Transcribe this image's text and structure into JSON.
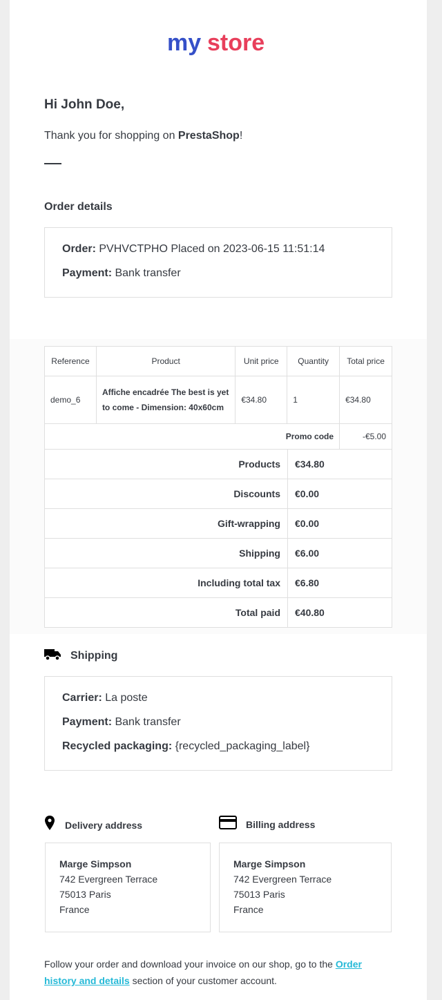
{
  "logo": {
    "text_my": "my",
    "text_store": "store"
  },
  "greeting": "Hi John Doe,",
  "thanks": {
    "prefix": "Thank you for shopping on ",
    "shop": "PrestaShop",
    "suffix": "!"
  },
  "order_details": {
    "title": "Order details",
    "order_label": "Order:",
    "order_value": "PVHVCTPHO Placed on 2023-06-15 11:51:14",
    "payment_label": "Payment:",
    "payment_value": "Bank transfer"
  },
  "products_table": {
    "headers": [
      "Reference",
      "Product",
      "Unit price",
      "Quantity",
      "Total price"
    ],
    "rows": [
      {
        "reference": "demo_6",
        "product": "Affiche encadrée The best is yet to come - Dimension: 40x60cm",
        "unit_price": "€34.80",
        "quantity": "1",
        "total_price": "€34.80"
      }
    ],
    "promo_label": "Promo code",
    "promo_value": "-€5.00"
  },
  "totals": [
    {
      "label": "Products",
      "value": "€34.80"
    },
    {
      "label": "Discounts",
      "value": "€0.00"
    },
    {
      "label": "Gift-wrapping",
      "value": "€0.00"
    },
    {
      "label": "Shipping",
      "value": "€6.00"
    },
    {
      "label": "Including total tax",
      "value": "€6.80"
    },
    {
      "label": "Total paid",
      "value": "€40.80"
    }
  ],
  "shipping": {
    "title": "Shipping",
    "carrier_label": "Carrier:",
    "carrier_value": "La poste",
    "payment_label": "Payment:",
    "payment_value": "Bank transfer",
    "recycled_label": "Recycled packaging:",
    "recycled_value": "{recycled_packaging_label}"
  },
  "delivery_address": {
    "title": "Delivery address",
    "name": "Marge Simpson",
    "street": "742 Evergreen Terrace",
    "city": "75013 Paris",
    "country": "France"
  },
  "billing_address": {
    "title": "Billing address",
    "name": "Marge Simpson",
    "street": "742 Evergreen Terrace",
    "city": "75013 Paris",
    "country": "France"
  },
  "footer": {
    "prefix": "Follow your order and download your invoice on our shop, go to the ",
    "link": "Order history and details",
    "suffix": " section of your customer account."
  },
  "icons": {
    "truck": "truck-icon",
    "pin": "map-pin-icon",
    "card": "credit-card-icon"
  },
  "colors": {
    "link": "#25b9d7",
    "text": "#363a41",
    "border": "#dfdfdf"
  }
}
